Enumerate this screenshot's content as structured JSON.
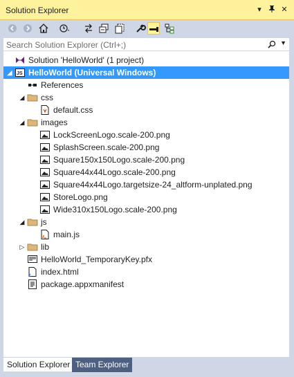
{
  "window": {
    "title": "Solution Explorer",
    "pin_glyph": "▾",
    "autohide_glyph": "📌",
    "close_glyph": "✕"
  },
  "toolbar": {
    "buttons": [
      {
        "name": "back",
        "icon": "back-arrow-icon"
      },
      {
        "name": "forward",
        "icon": "forward-arrow-icon"
      },
      {
        "name": "home",
        "icon": "home-icon"
      },
      {
        "name": "pending-changes",
        "icon": "clock-history-icon"
      },
      {
        "name": "sync",
        "icon": "sync-arrows-icon"
      },
      {
        "name": "collapse-all",
        "icon": "collapse-all-icon"
      },
      {
        "name": "show-all-files",
        "icon": "show-all-files-icon"
      },
      {
        "name": "properties",
        "icon": "wrench-icon"
      },
      {
        "name": "preview-selected",
        "icon": "preview-icon",
        "active": true
      },
      {
        "name": "class-view",
        "icon": "class-view-icon"
      }
    ]
  },
  "search": {
    "placeholder": "Search Solution Explorer (Ctrl+;)"
  },
  "tree": [
    {
      "label": "Solution 'HelloWorld' (1 project)",
      "icon": "solution-icon",
      "indent": 0,
      "expander": ""
    },
    {
      "label": "HelloWorld (Universal Windows)",
      "icon": "js-project-icon",
      "indent": 0,
      "expander": "◢",
      "selected": true
    },
    {
      "label": "References",
      "icon": "references-icon",
      "indent": 1,
      "expander": ""
    },
    {
      "label": "css",
      "icon": "folder-icon",
      "indent": 1,
      "expander": "◢"
    },
    {
      "label": "default.css",
      "icon": "css-file-icon",
      "indent": 2,
      "expander": ""
    },
    {
      "label": "images",
      "icon": "folder-icon",
      "indent": 1,
      "expander": "◢"
    },
    {
      "label": "LockScreenLogo.scale-200.png",
      "icon": "image-file-icon",
      "indent": 2,
      "expander": ""
    },
    {
      "label": "SplashScreen.scale-200.png",
      "icon": "image-file-icon",
      "indent": 2,
      "expander": ""
    },
    {
      "label": "Square150x150Logo.scale-200.png",
      "icon": "image-file-icon",
      "indent": 2,
      "expander": ""
    },
    {
      "label": "Square44x44Logo.scale-200.png",
      "icon": "image-file-icon",
      "indent": 2,
      "expander": ""
    },
    {
      "label": "Square44x44Logo.targetsize-24_altform-unplated.png",
      "icon": "image-file-icon",
      "indent": 2,
      "expander": ""
    },
    {
      "label": "StoreLogo.png",
      "icon": "image-file-icon",
      "indent": 2,
      "expander": ""
    },
    {
      "label": "Wide310x150Logo.scale-200.png",
      "icon": "image-file-icon",
      "indent": 2,
      "expander": ""
    },
    {
      "label": "js",
      "icon": "folder-icon",
      "indent": 1,
      "expander": "◢"
    },
    {
      "label": "main.js",
      "icon": "js-file-icon",
      "indent": 2,
      "expander": ""
    },
    {
      "label": "lib",
      "icon": "folder-icon",
      "indent": 1,
      "expander": "▷"
    },
    {
      "label": "HelloWorld_TemporaryKey.pfx",
      "icon": "certificate-file-icon",
      "indent": 1,
      "expander": ""
    },
    {
      "label": "index.html",
      "icon": "html-file-icon",
      "indent": 1,
      "expander": ""
    },
    {
      "label": "package.appxmanifest",
      "icon": "manifest-file-icon",
      "indent": 1,
      "expander": ""
    }
  ],
  "tabs": [
    {
      "label": "Solution Explorer",
      "active": true
    },
    {
      "label": "Team Explorer",
      "active": false
    }
  ],
  "colors": {
    "accent": "#3399ff",
    "titlebar": "#fff29d",
    "chrome": "#cfd6e5",
    "tab_inactive": "#4d6082"
  }
}
